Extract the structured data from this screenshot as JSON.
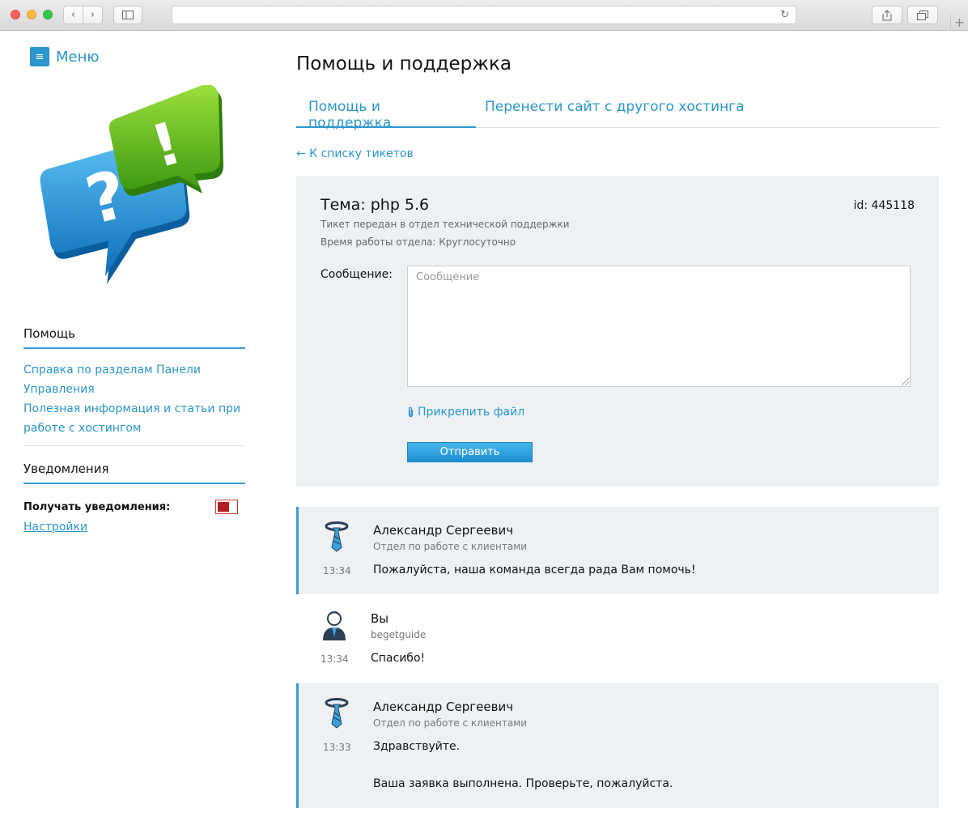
{
  "browser": {
    "plus_label": "+"
  },
  "sidebar": {
    "menu_label": "Меню",
    "help_heading": "Помощь",
    "help_links": [
      "Справка по разделам Панели Управления",
      "Полезная информация и статьи при работе с хостингом"
    ],
    "notifications_heading": "Уведомления",
    "receive_label": "Получать уведомления:",
    "receive_enabled": false,
    "settings_link": "Настройки"
  },
  "main": {
    "page_title": "Помощь и поддержка",
    "tabs": [
      {
        "label": "Помощь и поддержка",
        "active": true
      },
      {
        "label": "Перенести сайт с другого хостинга",
        "active": false
      }
    ],
    "back_link": "← К списку тикетов",
    "ticket": {
      "subject": "Тема: php 5.6",
      "id": "id: 445118",
      "status_line": "Тикет передан в отдел технической поддержки",
      "hours_line": "Время работы отдела: Круглосуточно",
      "message_label": "Сообщение:",
      "message_placeholder": "Сообщение",
      "message_value": "",
      "attach_label": "Прикрепить файл",
      "send_label": "Отправить"
    },
    "messages": [
      {
        "author": "Александр Сергеевич",
        "subtitle": "Отдел по работе с клиентами",
        "time": "13:34",
        "text": "Пожалуйста, наша команда всегда рада Вам помочь!",
        "text2": "",
        "from_support": true
      },
      {
        "author": "Вы",
        "subtitle": "begetguide",
        "time": "13:34",
        "text": "Спасибо!",
        "text2": "",
        "from_support": false
      },
      {
        "author": "Александр Сергеевич",
        "subtitle": "Отдел по работе с клиентами",
        "time": "13:33",
        "text": "Здравствуйте.",
        "text2": "Ваша заявка выполнена. Проверьте, пожалуйста.",
        "from_support": true
      }
    ]
  },
  "colors": {
    "accent": "#2b96cf",
    "panel": "#eef1f4",
    "toggle_off": "#b21e26"
  }
}
